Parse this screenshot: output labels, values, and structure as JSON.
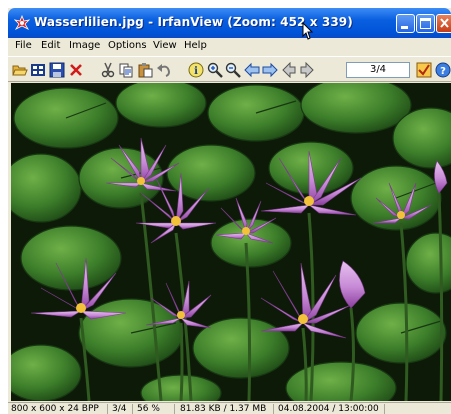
{
  "window": {
    "title": "Wasserlilien.jpg - IrfanView (Zoom: 452 x 339)"
  },
  "menu": [
    {
      "label": "File"
    },
    {
      "label": "Edit"
    },
    {
      "label": "Image"
    },
    {
      "label": "Options"
    },
    {
      "label": "View"
    },
    {
      "label": "Help"
    }
  ],
  "toolbar": {
    "icons": [
      "open-folder-icon",
      "thumbnails-icon",
      "save-icon",
      "delete-icon",
      "cut-icon",
      "copy-icon",
      "paste-icon",
      "undo-icon",
      "info-icon",
      "zoom-in-icon",
      "zoom-out-icon",
      "previous-icon",
      "next-icon",
      "first-icon",
      "last-icon",
      "checkbox-icon",
      "help-icon"
    ],
    "page_indicator": "3/4"
  },
  "image": {
    "filename": "Wasserlilien.jpg",
    "subject": "water lilies"
  },
  "status": {
    "dimensions": "800 x 600 x 24 BPP",
    "index": "3/4",
    "zoom": "56 %",
    "size": "81.83 KB / 1.37 MB",
    "date": "04.08.2004 / 13:00:00"
  },
  "colors": {
    "title_bar": "#0a5fe0",
    "chrome": "#ece9d8",
    "close_button": "#d4572b",
    "leaf_green": "#3c7d2a",
    "lily_pink": "#c98fd6"
  }
}
